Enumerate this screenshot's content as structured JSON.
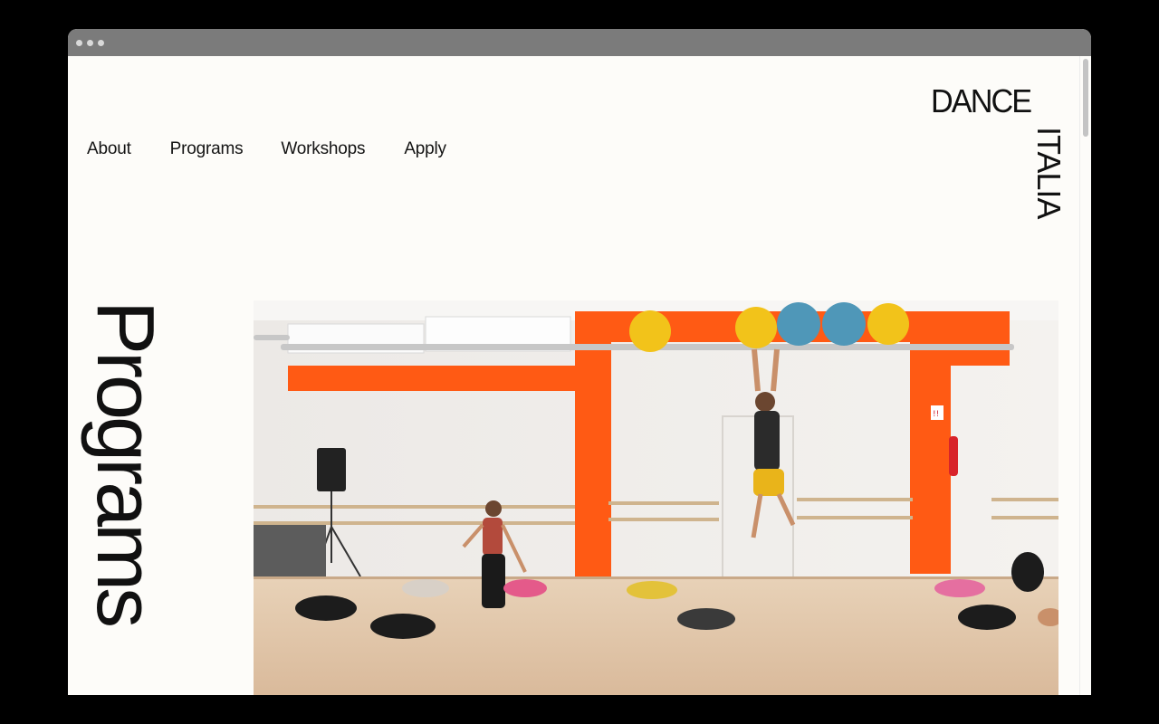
{
  "nav": {
    "items": [
      {
        "label": "About"
      },
      {
        "label": "Programs"
      },
      {
        "label": "Workshops"
      },
      {
        "label": "Apply"
      }
    ]
  },
  "logo": {
    "line1": "DANCE",
    "line2": "ITALIA"
  },
  "page": {
    "heading": "Programs"
  },
  "hero": {
    "sign": "!!"
  },
  "colors": {
    "background": "#fdfcf9",
    "text": "#141414",
    "accent_orange": "#ff5a14",
    "ball_yellow": "#f2c31a",
    "ball_blue": "#4f97b8"
  }
}
